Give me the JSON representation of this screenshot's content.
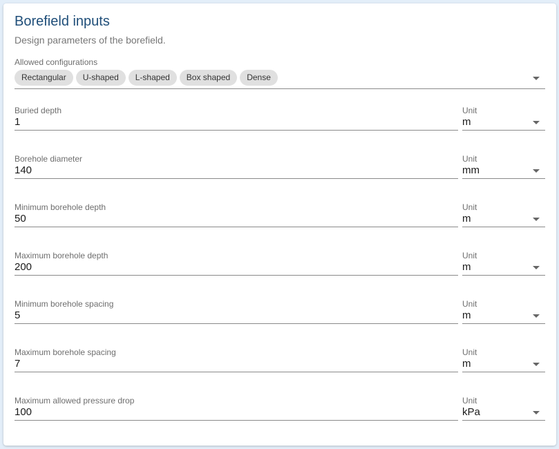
{
  "header": {
    "title": "Borefield inputs",
    "subtitle": "Design parameters of the borefield."
  },
  "configurations": {
    "label": "Allowed configurations",
    "chips": [
      "Rectangular",
      "U-shaped",
      "L-shaped",
      "Box shaped",
      "Dense"
    ]
  },
  "unit_label": "Unit",
  "fields": [
    {
      "label": "Buried depth",
      "value": "1",
      "unit": "m"
    },
    {
      "label": "Borehole diameter",
      "value": "140",
      "unit": "mm"
    },
    {
      "label": "Minimum borehole depth",
      "value": "50",
      "unit": "m"
    },
    {
      "label": "Maximum borehole depth",
      "value": "200",
      "unit": "m"
    },
    {
      "label": "Minimum borehole spacing",
      "value": "5",
      "unit": "m"
    },
    {
      "label": "Maximum borehole spacing",
      "value": "7",
      "unit": "m"
    },
    {
      "label": "Maximum allowed pressure drop",
      "value": "100",
      "unit": "kPa"
    }
  ]
}
